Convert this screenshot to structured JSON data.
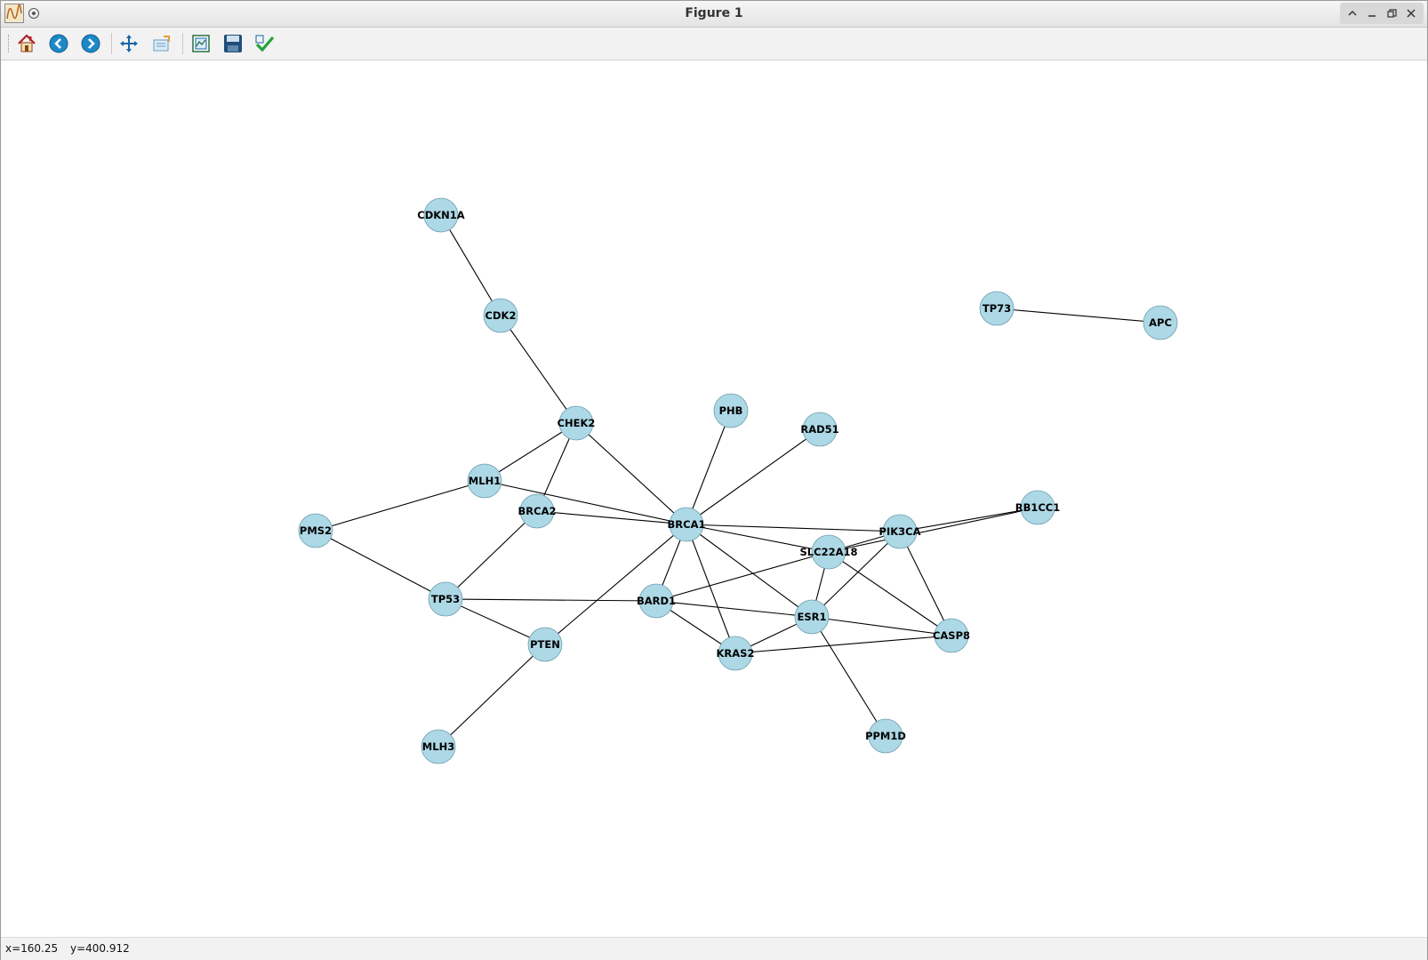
{
  "window": {
    "title": "Figure 1",
    "controls": [
      "up-icon",
      "minimize-icon",
      "restore-icon",
      "close-icon"
    ]
  },
  "toolbar": {
    "buttons": [
      {
        "name": "home-icon",
        "label": "Home"
      },
      {
        "name": "back-icon",
        "label": "Back"
      },
      {
        "name": "forward-icon",
        "label": "Forward"
      },
      {
        "name": "pan-icon",
        "label": "Pan"
      },
      {
        "name": "zoom-icon",
        "label": "Zoom"
      },
      {
        "name": "subplots-icon",
        "label": "Subplots"
      },
      {
        "name": "save-icon",
        "label": "Save"
      },
      {
        "name": "customize-icon",
        "label": "Customize"
      }
    ]
  },
  "status": {
    "x": "x=160.25",
    "y": "y=400.912"
  },
  "graph": {
    "node_color": "#add8e6",
    "edge_color": "#000000",
    "nodes": [
      "CDKN1A",
      "CDK2",
      "CHEK2",
      "PHB",
      "RAD51",
      "TP73",
      "APC",
      "MLH1",
      "BRCA2",
      "PMS2",
      "BRCA1",
      "PIK3CA",
      "RB1CC1",
      "SLC22A18",
      "TP53",
      "BARD1",
      "ESR1",
      "CASP8",
      "PTEN",
      "KRAS2",
      "MLH3",
      "PPM1D"
    ],
    "edges": [
      [
        "CDKN1A",
        "CDK2"
      ],
      [
        "CDK2",
        "CHEK2"
      ],
      [
        "CHEK2",
        "MLH1"
      ],
      [
        "CHEK2",
        "BRCA2"
      ],
      [
        "CHEK2",
        "BRCA1"
      ],
      [
        "PHB",
        "BRCA1"
      ],
      [
        "RAD51",
        "BRCA1"
      ],
      [
        "TP73",
        "APC"
      ],
      [
        "MLH1",
        "PMS2"
      ],
      [
        "MLH1",
        "BRCA1"
      ],
      [
        "BRCA2",
        "BRCA1"
      ],
      [
        "BRCA2",
        "TP53"
      ],
      [
        "PMS2",
        "TP53"
      ],
      [
        "TP53",
        "BARD1"
      ],
      [
        "TP53",
        "PTEN"
      ],
      [
        "PTEN",
        "BRCA1"
      ],
      [
        "PTEN",
        "MLH3"
      ],
      [
        "BRCA1",
        "PIK3CA"
      ],
      [
        "BRCA1",
        "SLC22A18"
      ],
      [
        "BRCA1",
        "BARD1"
      ],
      [
        "BRCA1",
        "ESR1"
      ],
      [
        "BRCA1",
        "KRAS2"
      ],
      [
        "BARD1",
        "SLC22A18"
      ],
      [
        "BARD1",
        "ESR1"
      ],
      [
        "BARD1",
        "KRAS2"
      ],
      [
        "SLC22A18",
        "PIK3CA"
      ],
      [
        "SLC22A18",
        "RB1CC1"
      ],
      [
        "SLC22A18",
        "ESR1"
      ],
      [
        "SLC22A18",
        "CASP8"
      ],
      [
        "PIK3CA",
        "RB1CC1"
      ],
      [
        "PIK3CA",
        "ESR1"
      ],
      [
        "PIK3CA",
        "CASP8"
      ],
      [
        "ESR1",
        "KRAS2"
      ],
      [
        "ESR1",
        "CASP8"
      ],
      [
        "ESR1",
        "PPM1D"
      ],
      [
        "KRAS2",
        "CASP8"
      ]
    ]
  }
}
